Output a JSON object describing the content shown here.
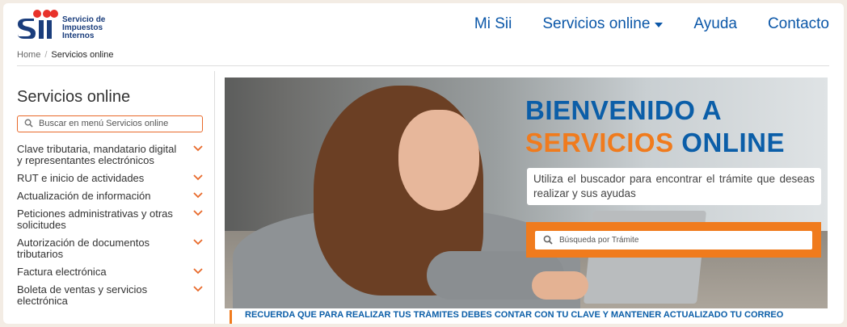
{
  "header": {
    "logo_text": [
      "Servicio de",
      "Impuestos",
      "Internos"
    ],
    "nav": {
      "mi_sii": "Mi Sii",
      "servicios": "Servicios online",
      "ayuda": "Ayuda",
      "contacto": "Contacto"
    }
  },
  "breadcrumb": {
    "home": "Home",
    "separator": "/",
    "current": "Servicios online"
  },
  "sidebar": {
    "title": "Servicios online",
    "search_placeholder": "Buscar en menú Servicios online",
    "items": [
      {
        "label": "Clave tributaria, mandatario digital y representantes electrónicos"
      },
      {
        "label": "RUT e inicio de actividades"
      },
      {
        "label": "Actualización de información"
      },
      {
        "label": "Peticiones administrativas y otras solicitudes"
      },
      {
        "label": "Autorización de documentos tributarios"
      },
      {
        "label": "Factura electrónica"
      },
      {
        "label": "Boleta de ventas y servicios electrónica"
      }
    ]
  },
  "banner": {
    "title_line1": "BIENVENIDO A",
    "title_line2_orange": "SERVICIOS",
    "title_line2_blue": "ONLINE",
    "description": "Utiliza el buscador para encontrar el trámite que deseas realizar y sus ayudas",
    "search_placeholder": "Búsqueda por Trámite"
  },
  "ticker": {
    "text": "RECUERDA QUE PARA REALIZAR TUS TRÁMITES DEBES CONTAR CON TU CLAVE Y MANTENER ACTUALIZADO TU CORREO"
  },
  "colors": {
    "brand_blue": "#0b5ea8",
    "accent_orange": "#f07b1d"
  }
}
